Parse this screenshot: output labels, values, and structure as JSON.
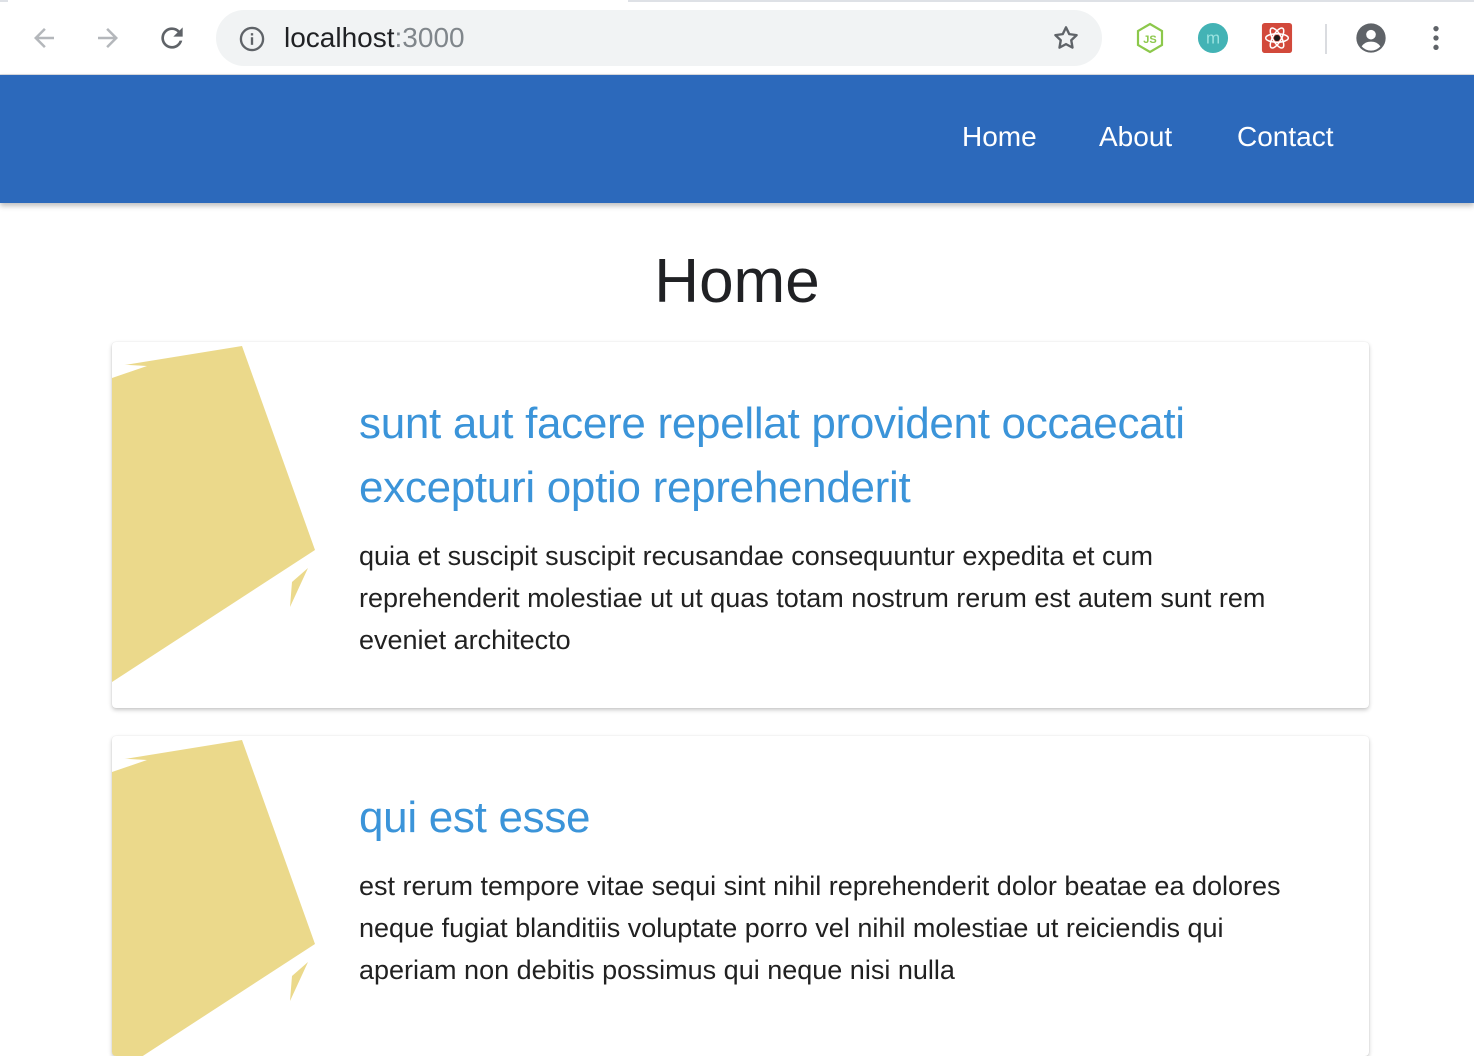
{
  "browser": {
    "url_host": "localhost",
    "url_port": ":3000",
    "icons": {
      "back": "arrow-left-icon",
      "forward": "arrow-right-icon",
      "reload": "reload-icon",
      "info": "info-icon",
      "bookmark": "star-icon",
      "ext_node": "nodejs-extension-icon",
      "ext_m": "m-extension-icon",
      "ext_react": "react-devtools-extension-icon",
      "profile": "profile-icon",
      "menu": "kebab-menu-icon"
    },
    "ext_m_letter": "m",
    "ext_node_label": "JS"
  },
  "header": {
    "nav": [
      "Home",
      "About",
      "Contact"
    ],
    "background": "#2c69bb"
  },
  "page": {
    "title": "Home"
  },
  "posts": [
    {
      "title": "sunt aut facere repellat provident occaecati excepturi optio reprehenderit",
      "body": "quia et suscipit suscipit recusandae consequuntur expedita et cum reprehenderit molestiae ut ut quas totam nostrum rerum est autem sunt rem eveniet architecto"
    },
    {
      "title": "qui est esse",
      "body": "est rerum tempore vitae sequi sint nihil reprehenderit dolor beatae ea dolores neque fugiat blanditiis voluptate porro vel nihil molestiae ut reiciendis qui aperiam non debitis possimus qui neque nisi nulla"
    }
  ],
  "colors": {
    "accent": "#3b94d9",
    "thumb": "#ebd98b"
  }
}
